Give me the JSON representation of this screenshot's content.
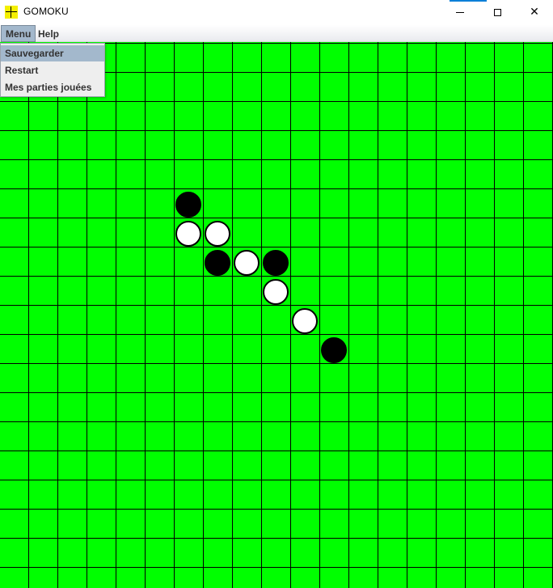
{
  "window": {
    "title": "GOMOKU",
    "controls": [
      "minimize-icon",
      "maximize-icon",
      "close-icon"
    ],
    "accent_color": "#0a7fd8"
  },
  "menubar": {
    "items": [
      {
        "label": "Menu",
        "active": true
      },
      {
        "label": "Help",
        "active": false
      }
    ]
  },
  "menu_dropdown": {
    "items": [
      {
        "label": "Sauvegarder",
        "selected": true
      },
      {
        "label": "Restart",
        "selected": false
      },
      {
        "label": "Mes parties jouées",
        "selected": false
      }
    ]
  },
  "board": {
    "background_color": "#00ff00",
    "line_color": "#000000",
    "stones": [
      {
        "col": 6,
        "row": 6,
        "color": "black"
      },
      {
        "col": 6,
        "row": 7,
        "color": "white"
      },
      {
        "col": 7,
        "row": 7,
        "color": "white"
      },
      {
        "col": 7,
        "row": 8,
        "color": "black"
      },
      {
        "col": 8,
        "row": 8,
        "color": "white"
      },
      {
        "col": 9,
        "row": 8,
        "color": "black"
      },
      {
        "col": 9,
        "row": 9,
        "color": "white"
      },
      {
        "col": 10,
        "row": 10,
        "color": "white"
      },
      {
        "col": 11,
        "row": 11,
        "color": "black"
      }
    ]
  }
}
